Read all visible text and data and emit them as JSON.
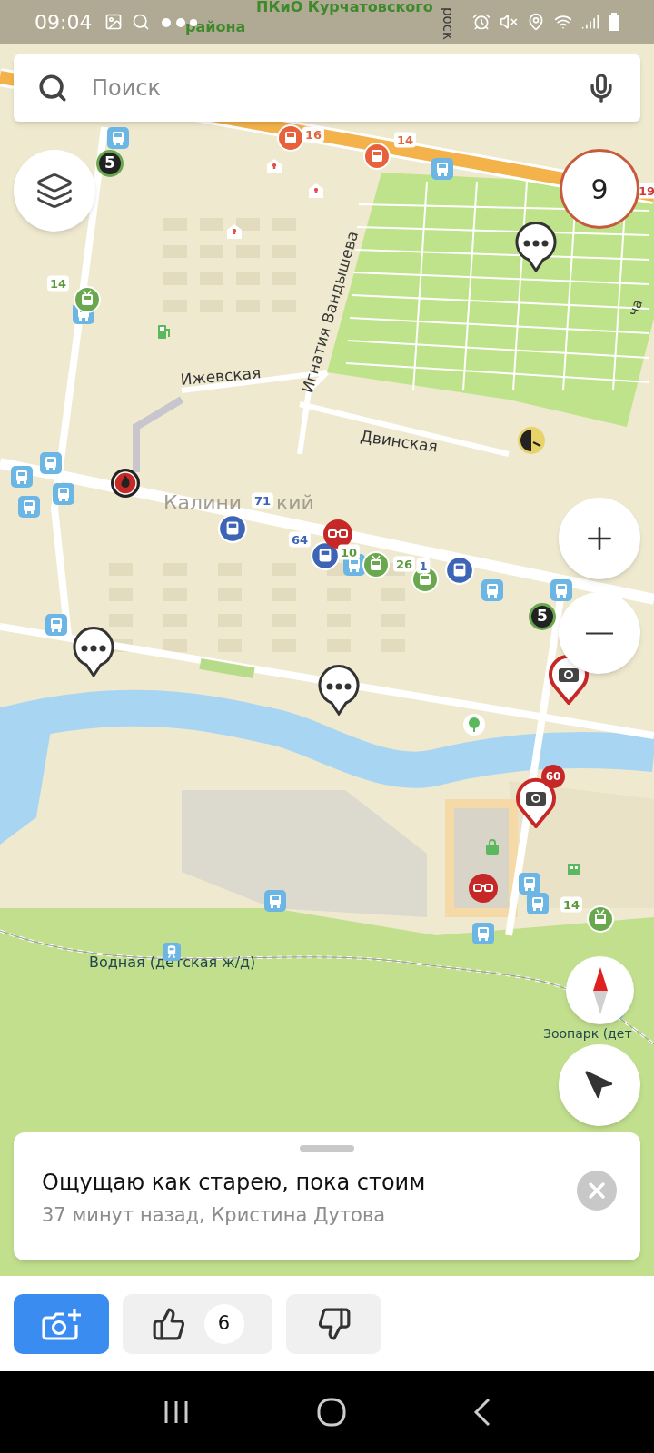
{
  "status_bar": {
    "time": "09:04"
  },
  "search": {
    "placeholder": "Поиск"
  },
  "map": {
    "labels": [
      {
        "text": "ПКиО Курчатовского",
        "kind": "park"
      },
      {
        "text": "района",
        "kind": "park"
      },
      {
        "text": "роск",
        "kind": "street_vertical"
      },
      {
        "text": "Игнатия Вандышева",
        "kind": "street_vertical"
      },
      {
        "text": "ча",
        "kind": "street_vertical"
      },
      {
        "text": "Ижевская",
        "kind": "street"
      },
      {
        "text": "Двинская",
        "kind": "street"
      },
      {
        "text": "Калини",
        "kind": "district"
      },
      {
        "text": "кий",
        "kind": "district"
      },
      {
        "text": "Водная (детская ж/д)",
        "kind": "station"
      },
      {
        "text": "Зоопарк (дет",
        "kind": "station"
      }
    ],
    "route_labels": [
      {
        "text": "16",
        "color": "#e0663e"
      },
      {
        "text": "14",
        "color": "#e0663e"
      },
      {
        "text": "19",
        "color": "#d23b3b"
      },
      {
        "text": "14",
        "color": "#5d9a3a"
      },
      {
        "text": "71",
        "color": "#3f65b5"
      },
      {
        "text": "64",
        "color": "#3f65b5"
      },
      {
        "text": "10",
        "color": "#5d9a3a"
      },
      {
        "text": "26",
        "color": "#5d9a3a"
      },
      {
        "text": "1",
        "color": "#3f65b5"
      },
      {
        "text": "14",
        "color": "#5d9a3a"
      }
    ],
    "badges": [
      "5",
      "5"
    ],
    "events_count": "9",
    "camera_speed": "60"
  },
  "post": {
    "text": "Ощущаю как старею, пока стоим",
    "meta": "37 минут назад, Кристина Дутова"
  },
  "actions": {
    "likes": "6"
  }
}
